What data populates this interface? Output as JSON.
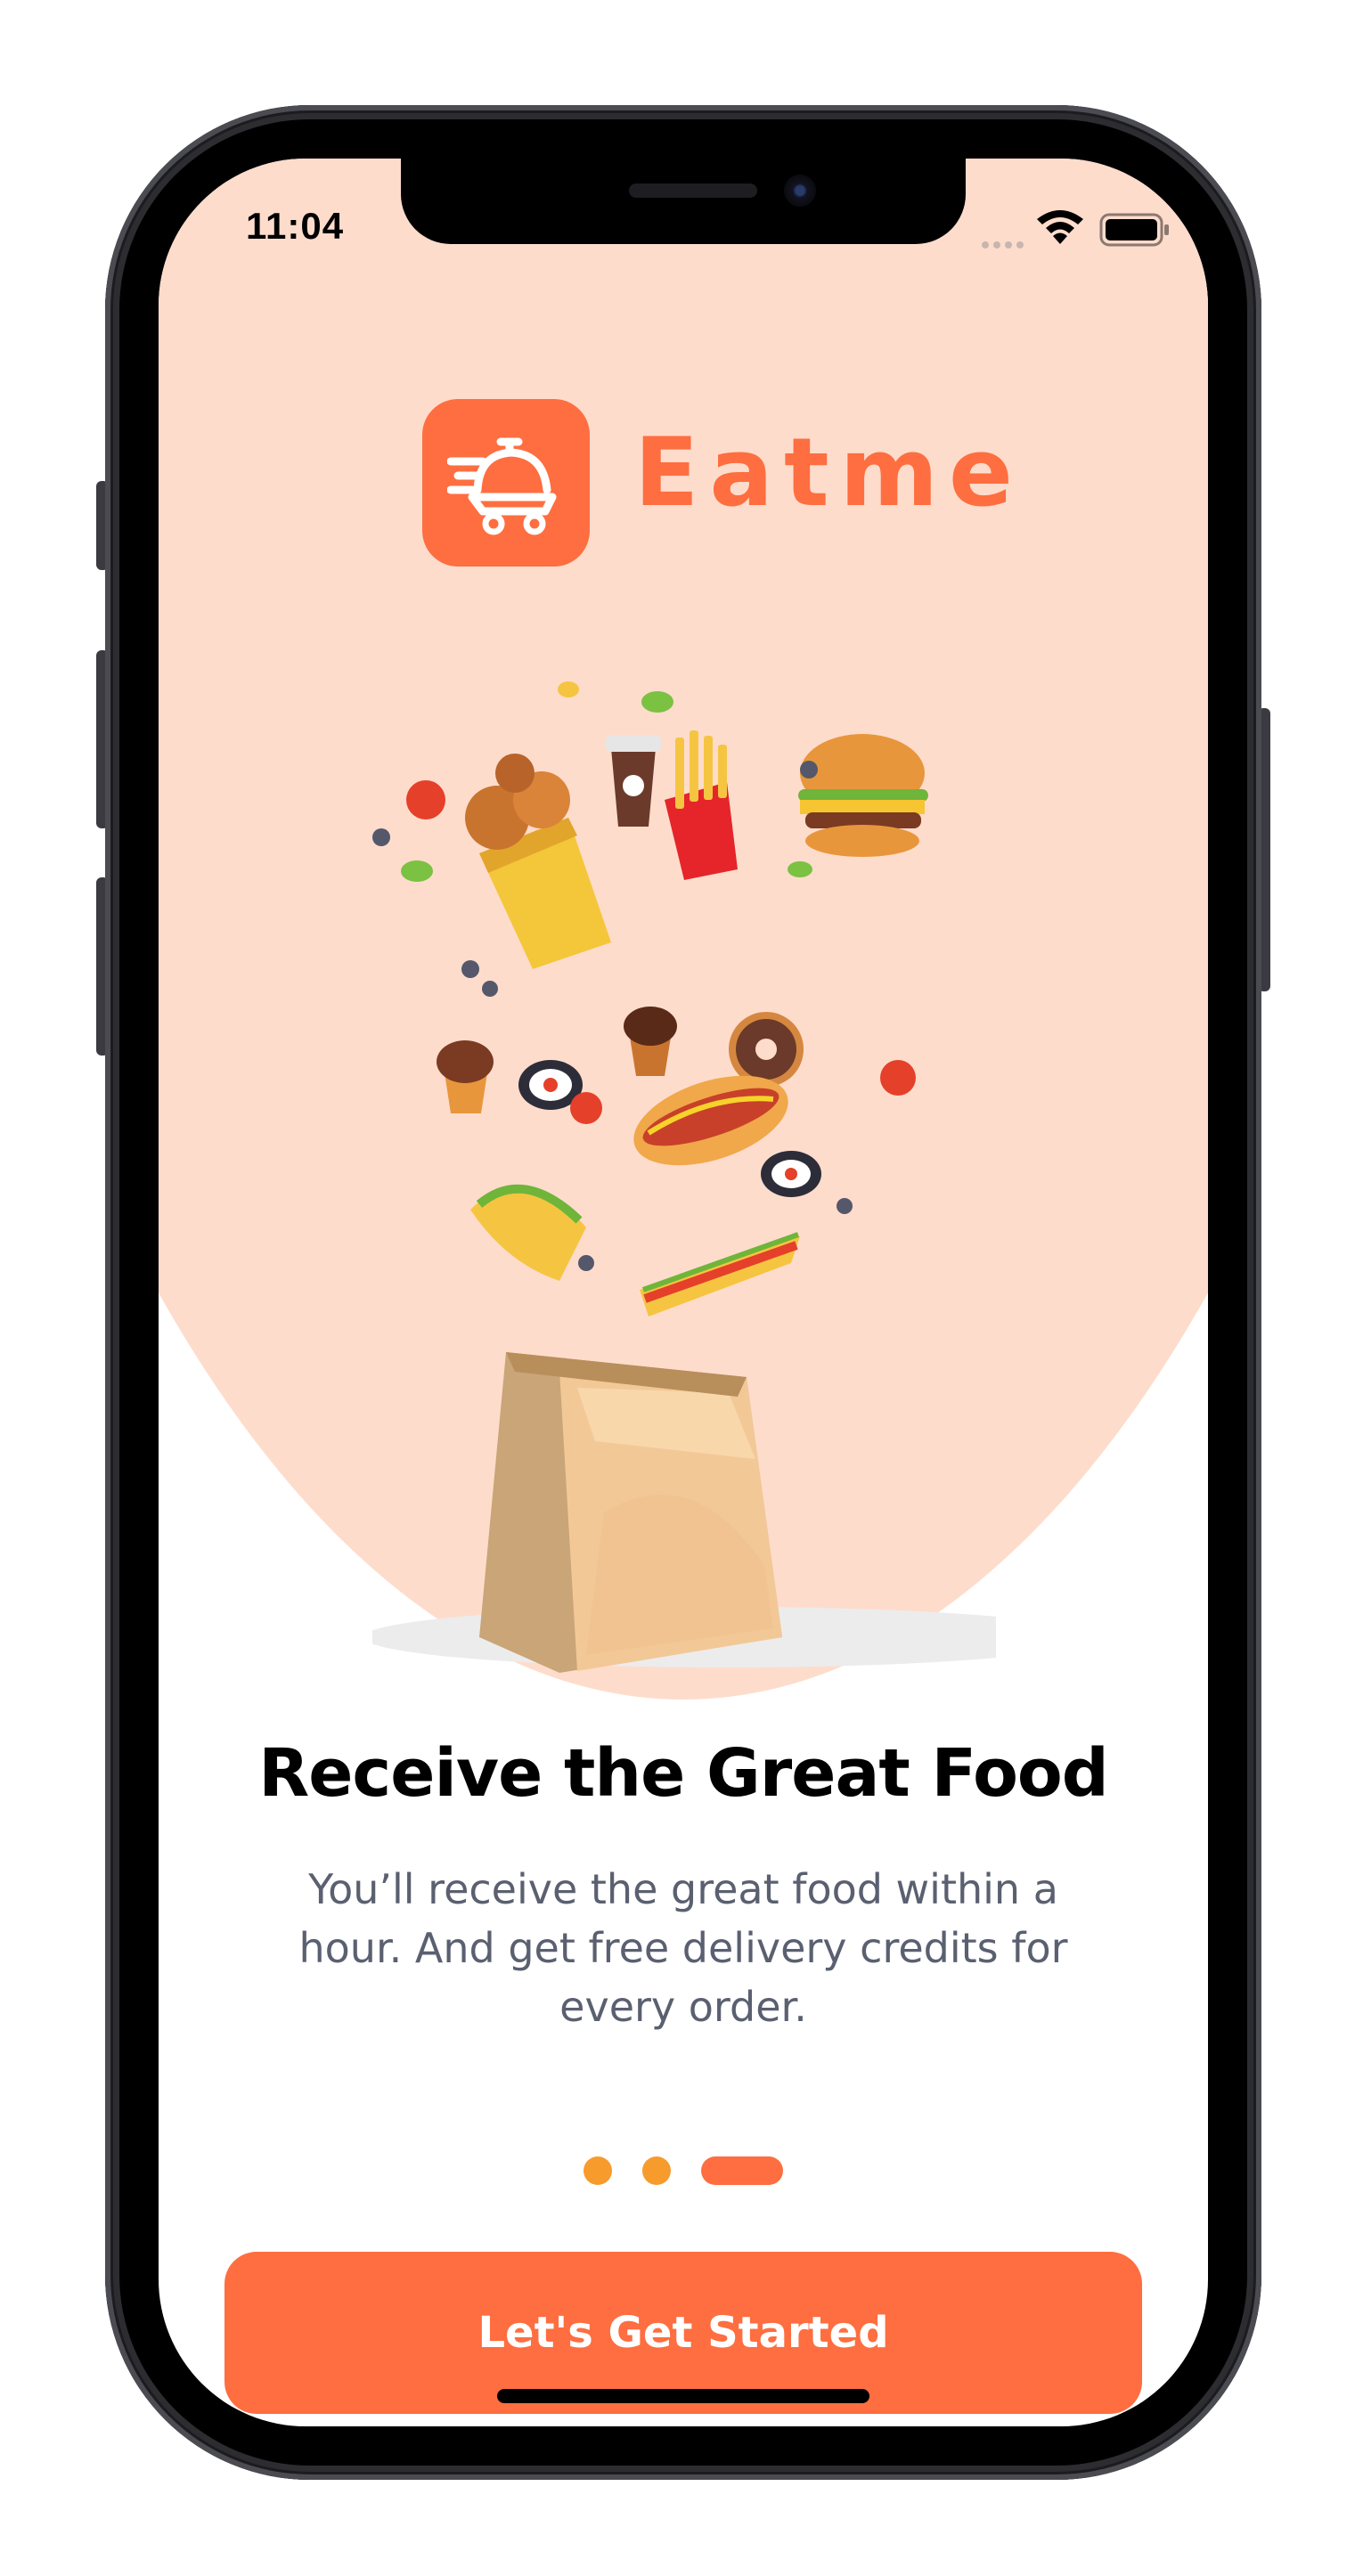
{
  "status_bar": {
    "time": "11:04"
  },
  "brand": {
    "name": "Eatme",
    "accent_color": "#FE6E40"
  },
  "onboarding": {
    "title": "Receive the Great Food",
    "description": "You’ll receive the great food within a hour. And get free delivery credits for every order.",
    "illustration": "food-bag-illustration",
    "pager": {
      "total": 3,
      "active_index": 2
    }
  },
  "cta": {
    "label": "Let's Get Started"
  },
  "colors": {
    "background_tint": "#FEDCCC",
    "dot": "#F79B2C",
    "text_muted": "#5A6070"
  }
}
